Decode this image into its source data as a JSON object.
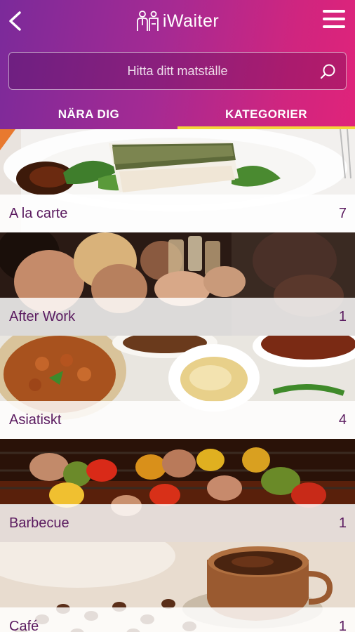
{
  "app": {
    "title": "iWaiter"
  },
  "search": {
    "placeholder": "Hitta ditt matställe"
  },
  "tabs": [
    {
      "label": "NÄRA DIG",
      "active": false
    },
    {
      "label": "KATEGORIER",
      "active": true
    }
  ],
  "categories": [
    {
      "name": "A la carte",
      "count": "7",
      "image": "plated-fish-dish"
    },
    {
      "name": "After Work",
      "count": "1",
      "image": "people-toasting-drinks"
    },
    {
      "name": "Asiatiskt",
      "count": "4",
      "image": "asian-dishes"
    },
    {
      "name": "Barbecue",
      "count": "1",
      "image": "grill-skewers"
    },
    {
      "name": "Café",
      "count": "1",
      "image": "coffee-cup-beans"
    }
  ],
  "colors": {
    "header_gradient_start": "#7b2a9a",
    "header_gradient_end": "#e0237a",
    "tab_indicator": "#f4d63a",
    "category_text": "#5a1a5f"
  },
  "icons": {
    "back": "chevron-left-icon",
    "menu": "hamburger-menu-icon",
    "search": "search-icon",
    "logo": "waiter-logo-icon"
  }
}
